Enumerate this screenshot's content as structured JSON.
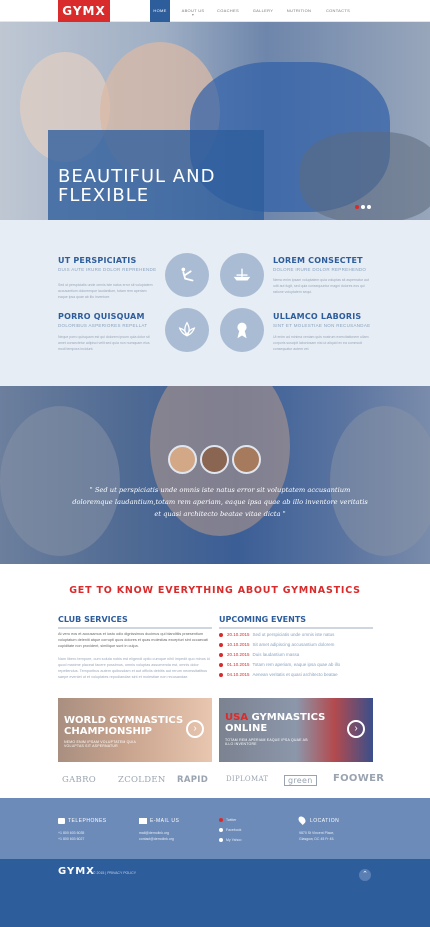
{
  "nav": {
    "logo": "GYMX",
    "items": [
      {
        "label": "HOME",
        "sub": ""
      },
      {
        "label": "ABOUT US",
        "sub": "▾"
      },
      {
        "label": "COACHES",
        "sub": ""
      },
      {
        "label": "GALLERY",
        "sub": ""
      },
      {
        "label": "NUTRITION",
        "sub": ""
      },
      {
        "label": "CONTACTS",
        "sub": ""
      }
    ]
  },
  "hero": {
    "title": "BEAUTIFUL AND\nFLEXIBLE",
    "slides": 3,
    "active_slide": 2
  },
  "features": [
    {
      "title": "UT PERSPICIATIS",
      "sub": "DUIS AUTE IRURE DOLOR REPREHENDE",
      "text": "Sed ut perspiciatis unde omnis iste natus error sit voluptatem accusantium doloremque laudantium, totam rem aperiam eaque ipsa quae ab illo inventore.",
      "icon": "stretch-icon"
    },
    {
      "title": "LOREM CONSECTET",
      "sub": "DOLORE IRURE DOLOR REPREHENDO",
      "text": "Nemo enim ipsam voluptatem quia voluptas sit aspernatur aut odit aut fugit, sed quia consequuntur magni dolores eos qui ratione voluptatem sequi.",
      "icon": "boat-icon"
    },
    {
      "title": "PORRO QUISQUAM",
      "sub": "DOLORIBUS ASPERIORES REPELLAT",
      "text": "Neque porro quisquam est qui dolorem ipsum quia dolor sit amet consectetur adipisci velit sed quia non numquam eius modi tempora incidunt.",
      "icon": "lotus-icon"
    },
    {
      "title": "ULLAMCO LABORIS",
      "sub": "SINT ET MOLESTIAE NON RECUSANDAE",
      "text": "Ut enim ad minima veniam quis nostrum exercitationem ullam corporis suscipit laboriosam nisi ut aliquid ex ea commodi consequatur autem vel.",
      "icon": "medal-icon"
    }
  ],
  "testimonial": {
    "quote": "\" Sed ut perspiciatis unde omnis iste natus error sit voluptatem accusantium doloremque laudantium,totam rem aperiam, eaque ipsa quae ab illo inventore veritatis et quasi architecto beatae vitae dicta \""
  },
  "gym": {
    "title": "GET TO KNOW EVERYTHING ABOUT GYMNASTICS",
    "club": {
      "title": "CLUB SERVICES",
      "lead": "At vero eos et accusamus et iusto odio dignissimos ducimus qui blanditiis praesentium voluptatum deleniti atque corrupti quos dolores et quas molestias excepturi sint occaecati cupiditate non provident, similique sunt in culpa.",
      "text": "Nam libero tempore, cum soluta nobis est eligendi optio cumque nihil impedit quo minus id quod maxime placeat facere possimus, omnis voluptas assumenda est, omnis dolor repellendus. Temporibus autem quibusdam et aut officiis debitis aut rerum necessitatibus saepe eveniet ut et voluptates repudiandae sint et molestiae non recusandae."
    },
    "events": {
      "title": "UPCOMING EVENTS",
      "items": [
        {
          "date": "20.10.2015",
          "text": "Sed ut perspiciatis unde omnis iste natus"
        },
        {
          "date": "10.10.2015",
          "text": "Sit amet adipiscing accusantium dolorem"
        },
        {
          "date": "20.10.2015",
          "text": "Duis laudantium massa"
        },
        {
          "date": "01.10.2015",
          "text": "Totam rem aperiam, eaque ipsa quae ab illo"
        },
        {
          "date": "04.10.2015",
          "text": "Aenean veritatis et quasi architecto beatae"
        }
      ]
    },
    "banners": [
      {
        "title": "WORLD GYMNASTICS\nCHAMPIONSHIP",
        "sub": "NEMO ENIM IPSAM VOLUPTATEM QUIA VOLUPTAS SIT ASPERNATUR"
      },
      {
        "title_accent": "USA",
        "title": " GYMNASTICS\nONLINE",
        "sub": "TOTAM REM APERIAM EAQUE IPSA QUAE AB ILLO INVENTORE"
      }
    ],
    "partners": [
      "GABRO",
      "ZCOLDEN",
      "RAPID",
      "DIPLOMAT",
      "green",
      "FOOWER"
    ]
  },
  "footer": {
    "telephones": {
      "title": "TELEPHONES",
      "lines": [
        "+1 800 603 6035",
        "+1 800 603 6027"
      ]
    },
    "email": {
      "title": "E-MAIL US",
      "lines": [
        "mail@demolink.org",
        "contact@demolink.org"
      ]
    },
    "social": [
      "Twitter",
      "Facebook",
      "My Yahoo"
    ],
    "location": {
      "title": "LOCATION",
      "lines": [
        "9870 St Vincent Place,",
        "Glasgow, DC 45 Fr 45."
      ]
    },
    "logo": "GYMX",
    "copyright": "© 2015 | PRIVACY POLICY"
  },
  "colors": {
    "brand_red": "#d92b2b",
    "brand_blue": "#2e5d9c",
    "footer_light": "#6c8bb9"
  }
}
